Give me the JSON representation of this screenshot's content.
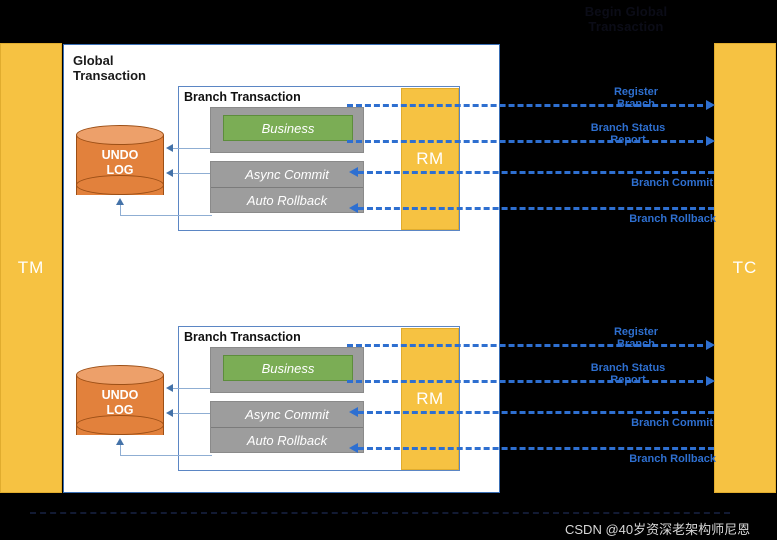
{
  "diagram": {
    "top_title": "Begin Global\nTransaction",
    "global_panel_label": "Global\nTransaction",
    "tm_label": "TM",
    "tc_label": "TC"
  },
  "branches": [
    {
      "title": "Branch Transaction",
      "business_label": "Business",
      "async_commit_label": "Async Commit",
      "auto_rollback_label": "Auto Rollback",
      "undo_log_label": "UNDO\nLOG",
      "rm_label": "RM",
      "messages": [
        {
          "label": "Register\nBranch",
          "direction": "right"
        },
        {
          "label": "Branch Status\nReport",
          "direction": "right"
        },
        {
          "label": "Branch Commit",
          "direction": "left"
        },
        {
          "label": "Branch Rollback",
          "direction": "left"
        }
      ]
    },
    {
      "title": "Branch Transaction",
      "business_label": "Business",
      "async_commit_label": "Async Commit",
      "auto_rollback_label": "Auto Rollback",
      "undo_log_label": "UNDO\nLOG",
      "rm_label": "RM",
      "messages": [
        {
          "label": "Register\nBranch",
          "direction": "right"
        },
        {
          "label": "Branch Status\nReport",
          "direction": "right"
        },
        {
          "label": "Branch Commit",
          "direction": "left"
        },
        {
          "label": "Branch Rollback",
          "direction": "left"
        }
      ]
    }
  ],
  "watermark": "CSDN @40岁资深老架构师尼恩",
  "colors": {
    "background": "#000000",
    "panel": "#ffffff",
    "bar_orange": "#f6c242",
    "cylinder_orange": "#e2813c",
    "business_green": "#7bad55",
    "box_grey": "#9d9d9d",
    "message_blue": "#2e6fd0",
    "connector_blue": "#8faed3"
  }
}
